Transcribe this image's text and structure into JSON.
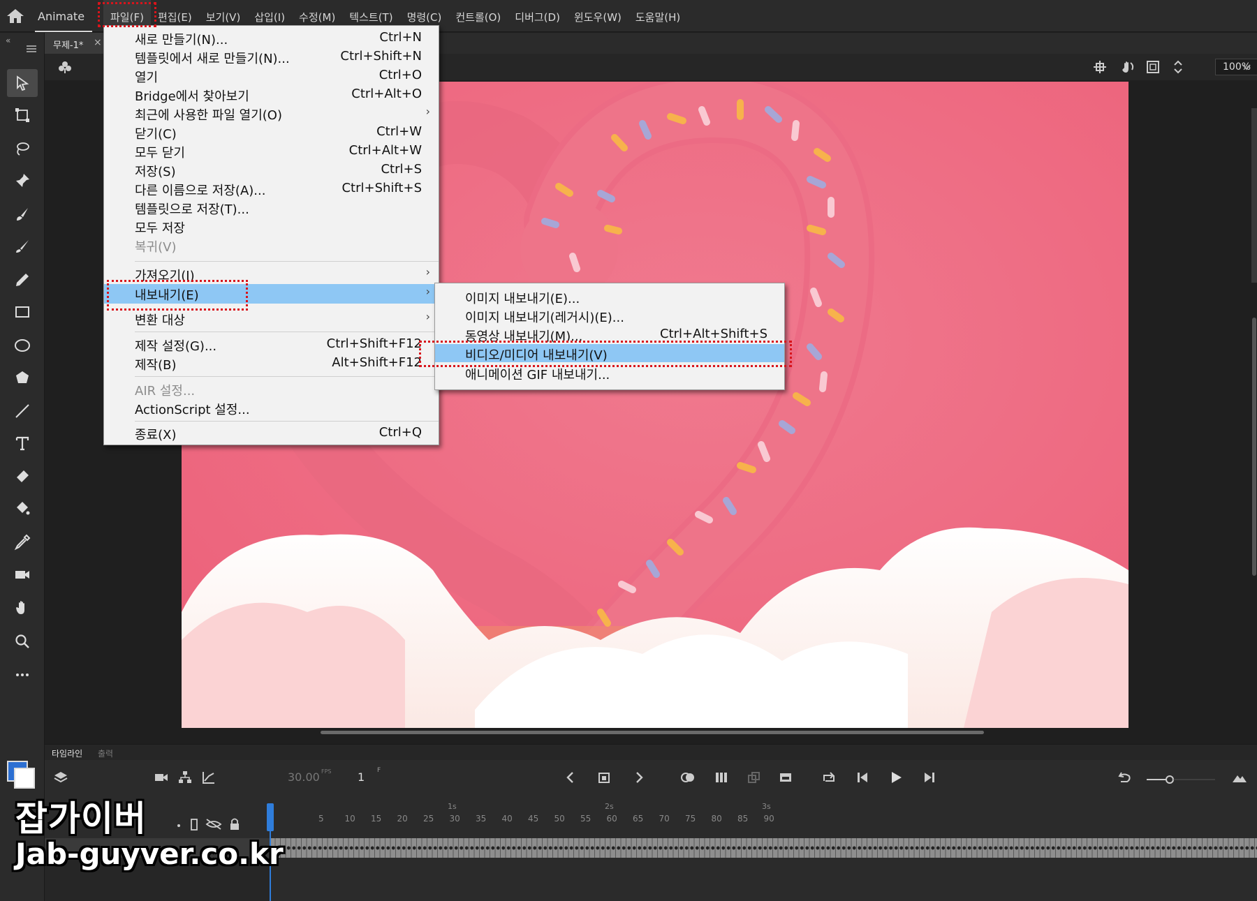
{
  "app": {
    "name": "Animate"
  },
  "menubar": {
    "items": [
      "파일(F)",
      "편집(E)",
      "보기(V)",
      "삽입(I)",
      "수정(M)",
      "텍스트(T)",
      "명령(C)",
      "컨트롤(O)",
      "디버그(D)",
      "윈도우(W)",
      "도움말(H)"
    ]
  },
  "document": {
    "tab_title": "무제-1*",
    "close_glyph": "×"
  },
  "stage": {
    "zoom": "100%"
  },
  "file_menu": {
    "items": [
      {
        "label": "새로 만들기(N)...",
        "shortcut": "Ctrl+N"
      },
      {
        "label": "템플릿에서 새로 만들기(N)...",
        "shortcut": "Ctrl+Shift+N"
      },
      {
        "label": "열기",
        "shortcut": "Ctrl+O"
      },
      {
        "label": "Bridge에서 찾아보기",
        "shortcut": "Ctrl+Alt+O"
      },
      {
        "label": "최근에 사용한 파일 열기(O)",
        "shortcut": "",
        "submenu": true
      },
      {
        "label": "닫기(C)",
        "shortcut": "Ctrl+W"
      },
      {
        "label": "모두 닫기",
        "shortcut": "Ctrl+Alt+W"
      },
      {
        "label": "저장(S)",
        "shortcut": "Ctrl+S"
      },
      {
        "label": "다른 이름으로 저장(A)...",
        "shortcut": "Ctrl+Shift+S"
      },
      {
        "label": "템플릿으로 저장(T)...",
        "shortcut": ""
      },
      {
        "label": "모두 저장",
        "shortcut": ""
      },
      {
        "label": "복귀(V)",
        "shortcut": "",
        "disabled": true
      },
      {
        "label": "가져오기(I)",
        "shortcut": "",
        "submenu": true
      },
      {
        "label": "내보내기(E)",
        "shortcut": "",
        "submenu": true,
        "highlighted": true
      },
      {
        "label": "변환 대상",
        "shortcut": "",
        "submenu": true
      },
      {
        "label": "제작 설정(G)...",
        "shortcut": "Ctrl+Shift+F12"
      },
      {
        "label": "제작(B)",
        "shortcut": "Alt+Shift+F12"
      },
      {
        "label": "AIR 설정...",
        "shortcut": "",
        "disabled": true
      },
      {
        "label": "ActionScript 설정...",
        "shortcut": ""
      },
      {
        "label": "종료(X)",
        "shortcut": "Ctrl+Q"
      }
    ]
  },
  "export_submenu": {
    "items": [
      {
        "label": "이미지 내보내기(E)...",
        "shortcut": ""
      },
      {
        "label": "이미지 내보내기(레거시)(E)...",
        "shortcut": ""
      },
      {
        "label": "동영상 내보내기(M)...",
        "shortcut": "Ctrl+Alt+Shift+S"
      },
      {
        "label": "비디오/미디어 내보내기(V)",
        "shortcut": "",
        "highlighted": true
      },
      {
        "label": "애니메이션 GIF 내보내기...",
        "shortcut": ""
      }
    ]
  },
  "timeline": {
    "tab_timeline": "타임라인",
    "tab_output": "출력",
    "fps": "30.00",
    "fps_unit": "FPS",
    "current_frame": "1",
    "frame_unit": "F",
    "second_marks": [
      "1s",
      "2s",
      "3s"
    ],
    "frame_ticks": [
      "5",
      "10",
      "15",
      "20",
      "25",
      "30",
      "35",
      "40",
      "45",
      "50",
      "55",
      "60",
      "65",
      "70",
      "75",
      "80",
      "85",
      "90"
    ]
  },
  "watermark": {
    "title": "잡가이버",
    "url": "Jab-guyver.co.kr"
  },
  "colors": {
    "accent_blue": "#2f7ddb",
    "menu_highlight": "#8ec7f4",
    "annotation_red": "#d8141b",
    "canvas_pink": "#ef6e84"
  }
}
